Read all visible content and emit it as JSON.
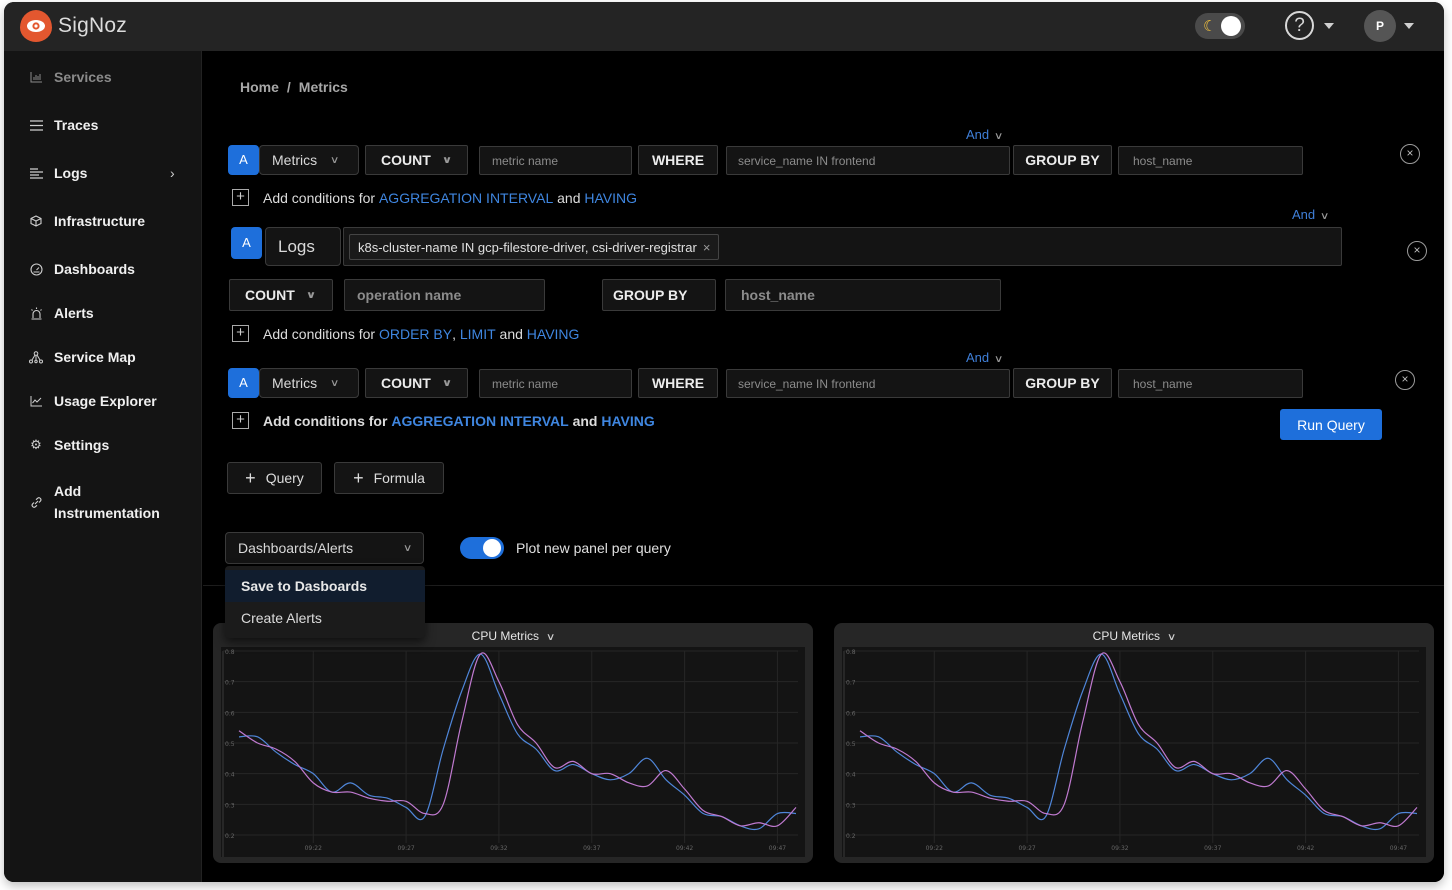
{
  "app": {
    "brand": "SigNoz",
    "theme_toggle_icon": "moon-icon",
    "help_icon": "question-circle-icon",
    "user_avatar_initial": "P"
  },
  "sidebar": {
    "items": [
      {
        "label": "Services",
        "icon": "bar-chart-icon"
      },
      {
        "label": "Traces",
        "icon": "menu-icon"
      },
      {
        "label": "Logs",
        "icon": "logs-icon",
        "has_submenu": true
      },
      {
        "label": "Infrastructure",
        "icon": "cube-icon"
      },
      {
        "label": "Dashboards",
        "icon": "dashboard-gauge-icon"
      },
      {
        "label": "Alerts",
        "icon": "alarm-icon"
      },
      {
        "label": "Service Map",
        "icon": "graph-nodes-icon"
      },
      {
        "label": "Usage Explorer",
        "icon": "line-chart-icon"
      },
      {
        "label": "Settings",
        "icon": "gear-icon"
      },
      {
        "label": "Add Instrumentation",
        "label_line1": "Add",
        "label_line2": "Instrumentation",
        "icon": "link-icon"
      }
    ]
  },
  "breadcrumb": {
    "home": "Home",
    "separator": "/",
    "current": "Metrics"
  },
  "queries": [
    {
      "label": "A",
      "source": "Metrics",
      "aggregation": "COUNT",
      "metric_placeholder": "metric name",
      "where_label": "WHERE",
      "where_value": "service_name IN frontend",
      "and_label": "And",
      "group_by_label": "GROUP BY",
      "group_by_value": "host_name",
      "add_conditions": {
        "prefix": "Add conditions for",
        "link1": "AGGREGATION INTERVAL",
        "joiner": "and",
        "link2": "HAVING"
      }
    },
    {
      "label": "A",
      "source": "Logs",
      "filter_tag": "k8s-cluster-name IN gcp-filestore-driver, csi-driver-registrar",
      "and_label": "And",
      "aggregation": "COUNT",
      "operation_placeholder": "operation name",
      "group_by_label": "GROUP BY",
      "group_by_value": "host_name",
      "add_conditions": {
        "prefix": "Add conditions for",
        "link1": "ORDER BY",
        "comma": ",",
        "link2": "LIMIT",
        "joiner": "and",
        "link3": "HAVING"
      }
    },
    {
      "label": "A",
      "source": "Metrics",
      "aggregation": "COUNT",
      "metric_placeholder": "metric name",
      "where_label": "WHERE",
      "where_value": "service_name IN frontend",
      "and_label": "And",
      "group_by_label": "GROUP BY",
      "group_by_value": "host_name",
      "add_conditions": {
        "prefix": "Add conditions for",
        "link1": "AGGREGATION INTERVAL",
        "joiner": "and",
        "link2": "HAVING"
      }
    }
  ],
  "actions": {
    "run_query": "Run Query",
    "add_query": "Query",
    "add_formula": "Formula"
  },
  "export": {
    "select_value": "Dashboards/Alerts",
    "options": [
      "Save to Dasboards",
      "Create Alerts"
    ],
    "active_option": 0,
    "toggle_label": "Plot new panel per query",
    "toggle_on": true
  },
  "colors": {
    "accent": "#1e6fdb",
    "link": "#3f86e0",
    "series_blue": "#4f86d9",
    "series_pink": "#c07ad0",
    "logo": "#e3572f"
  },
  "chart_data": [
    {
      "type": "line",
      "title": "CPU Metrics",
      "xlabel": "",
      "ylabel": "",
      "ylim": [
        0.2,
        0.8
      ],
      "yticks": [
        "0.8",
        "0.7",
        "0.6",
        "0.5",
        "0.4",
        "0.3",
        "0.2"
      ],
      "xticks": [
        "09:22",
        "09:27",
        "09:32",
        "09:37",
        "09:42",
        "09:47"
      ],
      "grid": true,
      "x": [
        "09:18",
        "09:19",
        "09:20",
        "09:21",
        "09:22",
        "09:23",
        "09:24",
        "09:25",
        "09:26",
        "09:27",
        "09:28",
        "09:29",
        "09:30",
        "09:31",
        "09:32",
        "09:33",
        "09:34",
        "09:35",
        "09:36",
        "09:37",
        "09:38",
        "09:39",
        "09:40",
        "09:41",
        "09:42",
        "09:43",
        "09:44",
        "09:45",
        "09:46",
        "09:47",
        "09:47.9"
      ],
      "series": [
        {
          "name": "series-blue",
          "color": "#4f86d9",
          "values": [
            0.52,
            0.52,
            0.47,
            0.43,
            0.4,
            0.34,
            0.37,
            0.33,
            0.32,
            0.29,
            0.26,
            0.48,
            0.67,
            0.79,
            0.66,
            0.53,
            0.48,
            0.41,
            0.43,
            0.4,
            0.38,
            0.4,
            0.45,
            0.38,
            0.33,
            0.27,
            0.26,
            0.23,
            0.22,
            0.27,
            0.27
          ]
        },
        {
          "name": "series-pink",
          "color": "#c07ad0",
          "values": [
            0.54,
            0.5,
            0.48,
            0.44,
            0.37,
            0.34,
            0.34,
            0.32,
            0.31,
            0.31,
            0.27,
            0.3,
            0.57,
            0.79,
            0.7,
            0.56,
            0.5,
            0.42,
            0.44,
            0.4,
            0.4,
            0.37,
            0.36,
            0.41,
            0.35,
            0.28,
            0.26,
            0.23,
            0.24,
            0.23,
            0.29
          ]
        }
      ]
    },
    {
      "type": "line",
      "title": "CPU Metrics",
      "xlabel": "",
      "ylabel": "",
      "ylim": [
        0.2,
        0.8
      ],
      "yticks": [
        "0.8",
        "0.7",
        "0.6",
        "0.5",
        "0.4",
        "0.3",
        "0.2"
      ],
      "xticks": [
        "09:22",
        "09:27",
        "09:32",
        "09:37",
        "09:42",
        "09:47"
      ],
      "grid": true,
      "x": [
        "09:18",
        "09:19",
        "09:20",
        "09:21",
        "09:22",
        "09:23",
        "09:24",
        "09:25",
        "09:26",
        "09:27",
        "09:28",
        "09:29",
        "09:30",
        "09:31",
        "09:32",
        "09:33",
        "09:34",
        "09:35",
        "09:36",
        "09:37",
        "09:38",
        "09:39",
        "09:40",
        "09:41",
        "09:42",
        "09:43",
        "09:44",
        "09:45",
        "09:46",
        "09:47",
        "09:47.9"
      ],
      "series": [
        {
          "name": "series-blue",
          "color": "#4f86d9",
          "values": [
            0.52,
            0.52,
            0.47,
            0.43,
            0.4,
            0.34,
            0.37,
            0.33,
            0.32,
            0.29,
            0.26,
            0.48,
            0.67,
            0.79,
            0.66,
            0.53,
            0.48,
            0.41,
            0.43,
            0.4,
            0.38,
            0.4,
            0.45,
            0.38,
            0.33,
            0.27,
            0.26,
            0.23,
            0.22,
            0.27,
            0.27
          ]
        },
        {
          "name": "series-pink",
          "color": "#c07ad0",
          "values": [
            0.54,
            0.5,
            0.48,
            0.44,
            0.37,
            0.34,
            0.34,
            0.32,
            0.31,
            0.31,
            0.27,
            0.3,
            0.57,
            0.79,
            0.7,
            0.56,
            0.5,
            0.42,
            0.44,
            0.4,
            0.4,
            0.37,
            0.36,
            0.41,
            0.35,
            0.28,
            0.26,
            0.23,
            0.24,
            0.23,
            0.29
          ]
        }
      ]
    }
  ]
}
